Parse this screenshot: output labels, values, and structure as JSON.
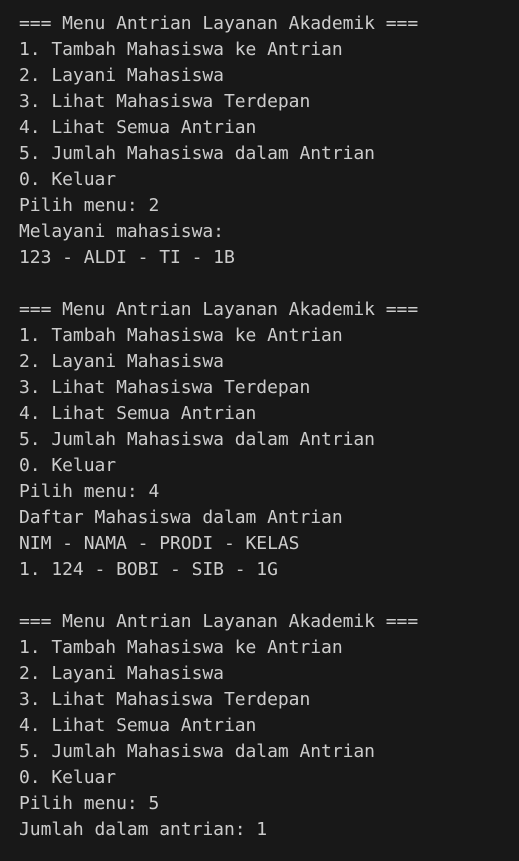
{
  "terminal": {
    "lines": [
      "=== Menu Antrian Layanan Akademik ===",
      "1. Tambah Mahasiswa ke Antrian",
      "2. Layani Mahasiswa",
      "3. Lihat Mahasiswa Terdepan",
      "4. Lihat Semua Antrian",
      "5. Jumlah Mahasiswa dalam Antrian",
      "0. Keluar",
      "Pilih menu: 2",
      "Melayani mahasiswa:",
      "123 - ALDI - TI - 1B",
      "",
      "=== Menu Antrian Layanan Akademik ===",
      "1. Tambah Mahasiswa ke Antrian",
      "2. Layani Mahasiswa",
      "3. Lihat Mahasiswa Terdepan",
      "4. Lihat Semua Antrian",
      "5. Jumlah Mahasiswa dalam Antrian",
      "0. Keluar",
      "Pilih menu: 4",
      "Daftar Mahasiswa dalam Antrian",
      "NIM - NAMA - PRODI - KELAS",
      "1. 124 - BOBI - SIB - 1G",
      "",
      "=== Menu Antrian Layanan Akademik ===",
      "1. Tambah Mahasiswa ke Antrian",
      "2. Layani Mahasiswa",
      "3. Lihat Mahasiswa Terdepan",
      "4. Lihat Semua Antrian",
      "5. Jumlah Mahasiswa dalam Antrian",
      "0. Keluar",
      "Pilih menu: 5",
      "Jumlah dalam antrian: 1"
    ],
    "colors": {
      "background": "#181818",
      "text": "#cccccc"
    }
  }
}
